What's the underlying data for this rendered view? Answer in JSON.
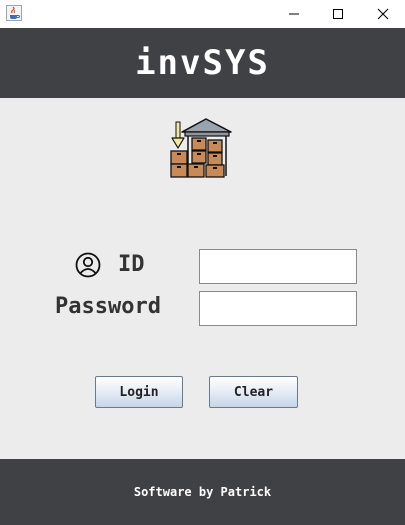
{
  "window": {
    "app_icon": "java-cup-icon",
    "controls": [
      "minimize-icon",
      "maximize-icon",
      "close-icon"
    ]
  },
  "header": {
    "title": "invSYS",
    "background": "#404145"
  },
  "logo": {
    "icon": "warehouse-boxes-icon"
  },
  "form": {
    "id_label": "ID",
    "id_value": "",
    "password_label": "Password",
    "password_value": "",
    "user_icon": "user-circle-icon"
  },
  "buttons": {
    "login_label": "Login",
    "clear_label": "Clear"
  },
  "footer": {
    "text": "Software by Patrick",
    "background": "#404145"
  }
}
